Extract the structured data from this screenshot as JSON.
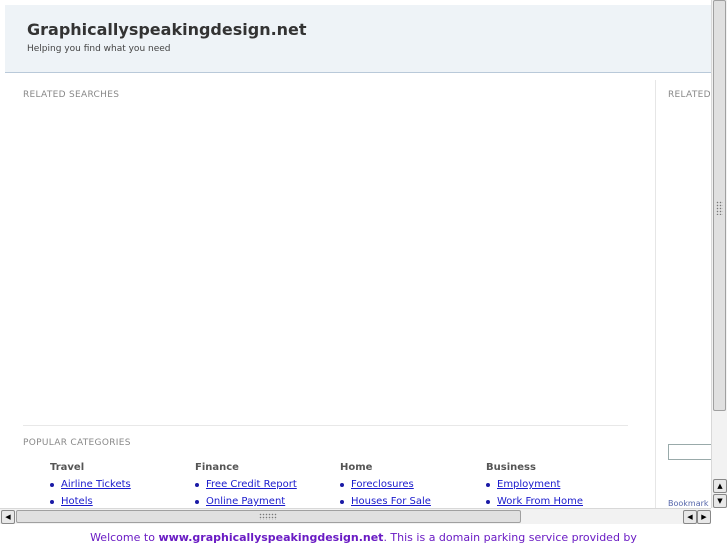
{
  "header": {
    "site_title": "Graphicallyspeakingdesign.net",
    "tagline": "Helping you find what you need"
  },
  "sections": {
    "related_searches": "RELATED SEARCHES",
    "related_side": "RELATED",
    "popular_categories": "POPULAR CATEGORIES"
  },
  "categories": [
    {
      "title": "Travel",
      "links": [
        "Airline Tickets",
        "Hotels"
      ]
    },
    {
      "title": "Finance",
      "links": [
        "Free Credit Report",
        "Online Payment"
      ]
    },
    {
      "title": "Home",
      "links": [
        "Foreclosures",
        "Houses For Sale"
      ]
    },
    {
      "title": "Business",
      "links": [
        "Employment",
        "Work From Home"
      ]
    }
  ],
  "sidebar": {
    "bookmark_label": "Bookmark"
  },
  "footer": {
    "welcome_prefix": "Welcome to ",
    "domain": "www.graphicallyspeakingdesign.net",
    "welcome_suffix": ". This is a domain parking service provided by"
  },
  "colors": {
    "header_bg": "#eef3f7",
    "link": "#1a1acc",
    "footer_text": "#6a1bc4"
  },
  "icons": {
    "scroll_up": "arrow-up-icon",
    "scroll_down": "arrow-down-icon",
    "scroll_left": "arrow-left-icon",
    "scroll_right": "arrow-right-icon"
  }
}
